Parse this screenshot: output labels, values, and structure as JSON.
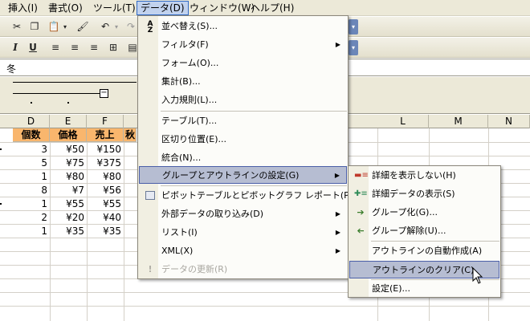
{
  "menubar": {
    "insert": "挿入(I)",
    "format": "書式(O)",
    "tools": "ツール(T)",
    "data": "データ(D)",
    "window": "ウィンドウ(W)",
    "help": "ヘルプ(H)"
  },
  "formula": {
    "value": "冬"
  },
  "columns": [
    "D",
    "E",
    "F",
    "L",
    "M",
    "N"
  ],
  "table": {
    "headers": [
      "個数",
      "価格",
      "売上"
    ],
    "rows": [
      [
        "3",
        "¥50",
        "¥150"
      ],
      [
        "5",
        "¥75",
        "¥375"
      ],
      [
        "1",
        "¥80",
        "¥80"
      ],
      [
        "8",
        "¥7",
        "¥56"
      ],
      [
        "1",
        "¥55",
        "¥55"
      ],
      [
        "2",
        "¥20",
        "¥40"
      ],
      [
        "1",
        "¥35",
        "¥35"
      ]
    ],
    "cut_header": "秋"
  },
  "data_menu": {
    "items": [
      "並べ替え(S)...",
      "フィルタ(F)",
      "フォーム(O)...",
      "集計(B)...",
      "入力規則(L)...",
      "テーブル(T)...",
      "区切り位置(E)...",
      "統合(N)...",
      "グループとアウトラインの設定(G)",
      "ピボットテーブルとピボットグラフ レポート(P)...",
      "外部データの取り込み(D)",
      "リスト(I)",
      "XML(X)",
      "データの更新(R)"
    ]
  },
  "outline_submenu": {
    "items": [
      "詳細を表示しない(H)",
      "詳細データの表示(S)",
      "グループ化(G)...",
      "グループ解除(U)...",
      "アウトラインの自動作成(A)",
      "アウトラインのクリア(C)",
      "設定(E)..."
    ]
  },
  "colors": {
    "menu_highlight": "#b6bdd2",
    "header_fill": "#f9b66d"
  }
}
